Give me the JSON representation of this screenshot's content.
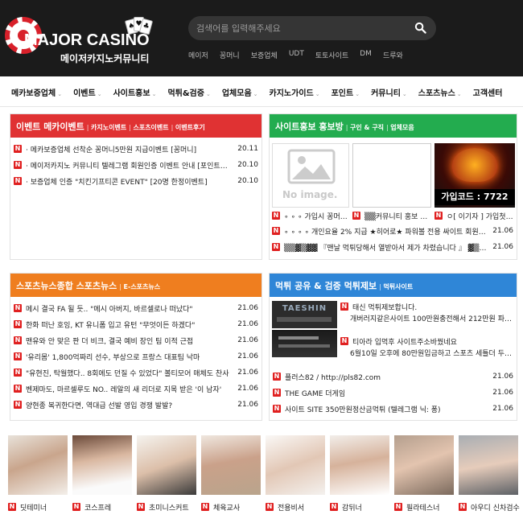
{
  "header": {
    "logo_text": "MAJOR CASINO",
    "logo_sub": "메이저카지노커뮤니티",
    "search_placeholder": "검색어를 입력해주세요",
    "quick_links": [
      "메이저",
      "꽁머니",
      "보증업체",
      "UDT",
      "토토사이트",
      "DM",
      "드루와"
    ]
  },
  "nav": {
    "items": [
      "메카보증업체",
      "이벤트",
      "사이트홍보",
      "먹튀&검증",
      "업체모음",
      "카지노가이드",
      "포인트",
      "커뮤니티",
      "스포츠뉴스",
      "고객센터"
    ]
  },
  "badge": "N",
  "colors": {
    "red": "#e03233",
    "green": "#23ac4f",
    "orange": "#ef7e1f",
    "blue": "#2f86d7",
    "badge": "#e02020"
  },
  "events": {
    "title": "이벤트   메카이벤트",
    "subs": [
      "카지노이벤트",
      "스포츠이벤트",
      "이벤트후기"
    ],
    "items": [
      {
        "text": "· 메카보증업체 선착순 꽁머니5만원 지급이벤트 [꽁머니]",
        "date": "20.11"
      },
      {
        "text": "· 메이저카지노 커뮤니티 텔레그램 회원인증 이벤트 안내 [포인트지급]",
        "date": "20.10"
      },
      {
        "text": "· 보증업체 인증 \"치킨기프티콘 EVENT\" [20명 한정이벤트]",
        "date": "20.10"
      }
    ]
  },
  "promo": {
    "title": "사이트홍보   홍보방",
    "subs": [
      "구인 & 구직",
      "업체모음"
    ],
    "noimage_label": "No image.",
    "banner_code": "가입코드 : 7722",
    "thumb_captions": [
      "∘ ∘ ∘ 가입시 꽁머니 ...",
      "▒▒커뮤니티 홍보 대...",
      "ㅇ[ 이기자 ] 가입첫충 ..."
    ],
    "items": [
      {
        "text": "∘ ∘ ∘ ∘ 개인요율 2% 지급 ★히어로★ 파워볼 전용 싸이트 회원,총판 모집...",
        "date": "21.06"
      },
      {
        "text": "▒▒▓▒▓▓ 『맨날 먹튀당해서 열받아서 제가 차렸습니다 』 ▓▒▒ ▓▒▒",
        "date": "21.06"
      }
    ]
  },
  "sports": {
    "title": "스포츠뉴스종합   스포츠뉴스",
    "subs": [
      "E-스포츠뉴스"
    ],
    "items": [
      {
        "text": "메시 결국 FA 될 듯.. \"메시 아버지, 바르셀로나 떠났다\"",
        "date": "21.06"
      },
      {
        "text": "한화 떠난 호잉, KT 유니폼 입고 유턴 \"무엇이든 하겠다\"",
        "date": "21.06"
      },
      {
        "text": "맨유와 안 맞은 판 더 비크, 결국 예비 장인 팀 이적 근접",
        "date": "21.06"
      },
      {
        "text": "'유리몸' 1,800억짜리 선수, 부상으로 프랑스 대표팀 낙마",
        "date": "21.06"
      },
      {
        "text": "\"유현진, 탁월했다.. 8회에도 던질 수 있었다\" 볼티모어 매체도 찬사",
        "date": "21.06"
      },
      {
        "text": "벤제마도, 마르셀루도 NO.. 레알의 새 리더로 지목 받은 '이 남자'",
        "date": "21.06"
      },
      {
        "text": "양현종 복귀한다면, 역대급 선발 영입 경쟁 발발?",
        "date": "21.06"
      }
    ]
  },
  "scam": {
    "title": "먹튀 공유 & 검증   먹튀제보",
    "subs": [
      "먹튀사이트"
    ],
    "thumb1_logo": "TAESHIN",
    "featured": [
      {
        "title": "태신 먹튀제보합니다.",
        "desc": "개버러지같은사이트 100만원충전해서 212만원 파워볼로 ..."
      },
      {
        "title": "티아라 입먹후 사이트주소바꿨네요",
        "desc": "6월10일 오후에 80만원입금하고 스포츠 세틀더 두박스 ..."
      }
    ],
    "items": [
      {
        "text": "플러스82 / http://pls82.com",
        "date": "21.06"
      },
      {
        "text": "THE GAME 더게임",
        "date": "21.06"
      },
      {
        "text": "사이트 SITE 350만원정산금먹튀 (텔레그램 닉: 퐁)",
        "date": "21.06"
      }
    ]
  },
  "gallery": {
    "captions": [
      "딧테미너",
      "코스프레",
      "초미니스커트",
      "체육교사",
      "전용비서",
      "감뒤너",
      "필라테스너",
      "아우디 신차검수"
    ]
  }
}
